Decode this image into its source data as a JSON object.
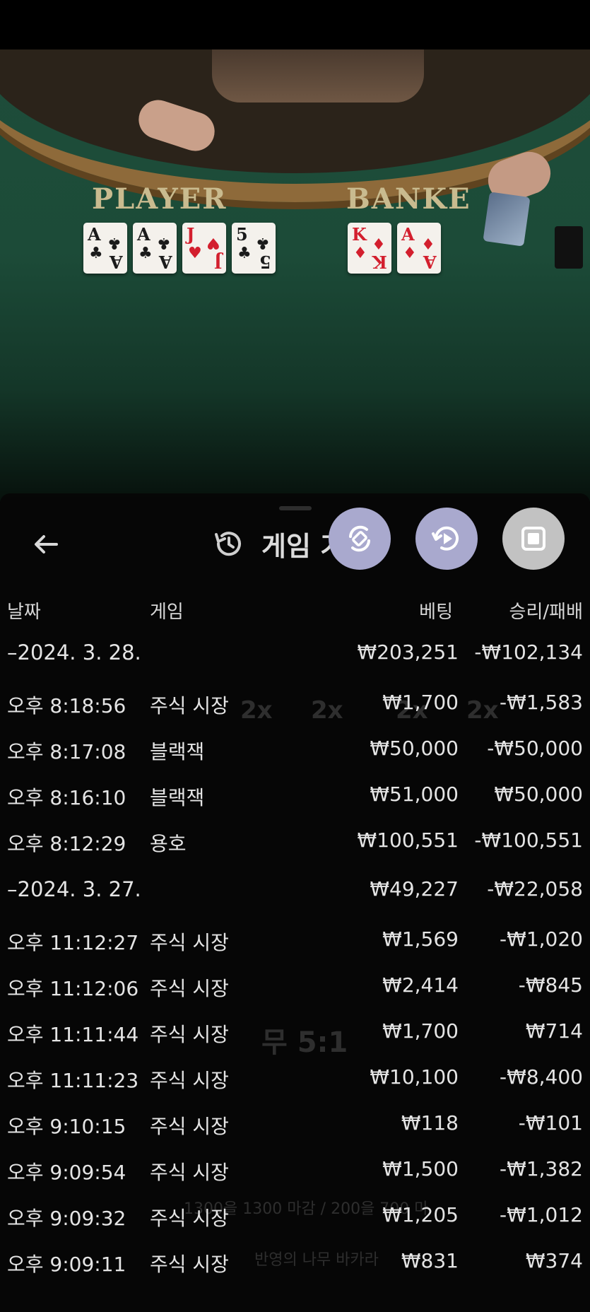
{
  "table": {
    "player_label": "PLAYER",
    "banker_label": "BANKE",
    "player_cards": [
      {
        "rank": "A",
        "suit": "♣",
        "color": "black"
      },
      {
        "rank": "A",
        "suit": "♣",
        "color": "black"
      },
      {
        "rank": "J",
        "suit": "♥",
        "color": "red"
      },
      {
        "rank": "5",
        "suit": "♣",
        "color": "black"
      }
    ],
    "banker_cards": [
      {
        "rank": "K",
        "suit": "♦",
        "color": "red"
      },
      {
        "rank": "A",
        "suit": "♦",
        "color": "red"
      }
    ]
  },
  "sheet": {
    "title": "게임 기",
    "back_icon": "arrow-left-icon",
    "history_icon": "history-icon"
  },
  "fabs": [
    {
      "icon": "rotate-screen-icon",
      "color": "#a9a9ce"
    },
    {
      "icon": "replay-icon",
      "color": "#a9a9ce"
    },
    {
      "icon": "stop-square-icon",
      "color": "#c2c2c2"
    }
  ],
  "columns": {
    "date": "날짜",
    "game": "게임",
    "bet": "베팅",
    "result": "승리/패배"
  },
  "groups": [
    {
      "date": "–2024. 3. 28.",
      "bet_total": "₩203,251",
      "result_total": "-₩102,134",
      "rows": [
        {
          "time": "오후 8:18:56",
          "game": "주식 시장",
          "bet": "₩1,700",
          "result": "-₩1,583"
        },
        {
          "time": "오후 8:17:08",
          "game": "블랙잭",
          "bet": "₩50,000",
          "result": "-₩50,000"
        },
        {
          "time": "오후 8:16:10",
          "game": "블랙잭",
          "bet": "₩51,000",
          "result": "₩50,000"
        },
        {
          "time": "오후 8:12:29",
          "game": "용호",
          "bet": "₩100,551",
          "result": "-₩100,551"
        }
      ]
    },
    {
      "date": "–2024. 3. 27.",
      "bet_total": "₩49,227",
      "result_total": "-₩22,058",
      "rows": [
        {
          "time": "오후 11:12:27",
          "game": "주식 시장",
          "bet": "₩1,569",
          "result": "-₩1,020"
        },
        {
          "time": "오후 11:12:06",
          "game": "주식 시장",
          "bet": "₩2,414",
          "result": "-₩845"
        },
        {
          "time": "오후 11:11:44",
          "game": "주식 시장",
          "bet": "₩1,700",
          "result": "₩714"
        },
        {
          "time": "오후 11:11:23",
          "game": "주식 시장",
          "bet": "₩10,100",
          "result": "-₩8,400"
        },
        {
          "time": "오후 9:10:15",
          "game": "주식 시장",
          "bet": "₩118",
          "result": "-₩101"
        },
        {
          "time": "오후 9:09:54",
          "game": "주식 시장",
          "bet": "₩1,500",
          "result": "-₩1,382"
        },
        {
          "time": "오후 9:09:32",
          "game": "주식 시장",
          "bet": "₩1,205",
          "result": "-₩1,012"
        },
        {
          "time": "오후 9:09:11",
          "game": "주식 시장",
          "bet": "₩831",
          "result": "₩374"
        }
      ]
    }
  ],
  "background_ghost_text": {
    "tie": "무 5:1",
    "multipliers": [
      "2x",
      "2x",
      "2x",
      "2x"
    ],
    "notice": "1300을 1300 마감 / 200을 700 마",
    "footer": "반영의 나무 바카라"
  }
}
